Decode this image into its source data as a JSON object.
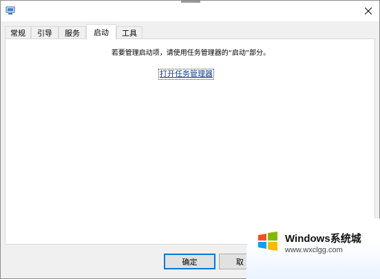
{
  "window": {
    "title": ""
  },
  "tabs": [
    {
      "label": "常规"
    },
    {
      "label": "引导"
    },
    {
      "label": "服务"
    },
    {
      "label": "启动",
      "active": true
    },
    {
      "label": "工具"
    }
  ],
  "startup_panel": {
    "hint_text": "若要管理启动项，请使用任务管理器的“启动”部分。",
    "open_task_manager_link": "打开任务管理器"
  },
  "footer": {
    "ok_label": "确定",
    "cancel_label": "取"
  },
  "watermark": {
    "brand_text": "Windows系统城",
    "url_text": "www.wxclgg.com",
    "icon": "windows-logo-icon"
  },
  "colors": {
    "accent": "#0078d7",
    "link": "#0d3b8c",
    "panel_bg": "#ffffff",
    "window_bg": "#f0f0f0"
  }
}
